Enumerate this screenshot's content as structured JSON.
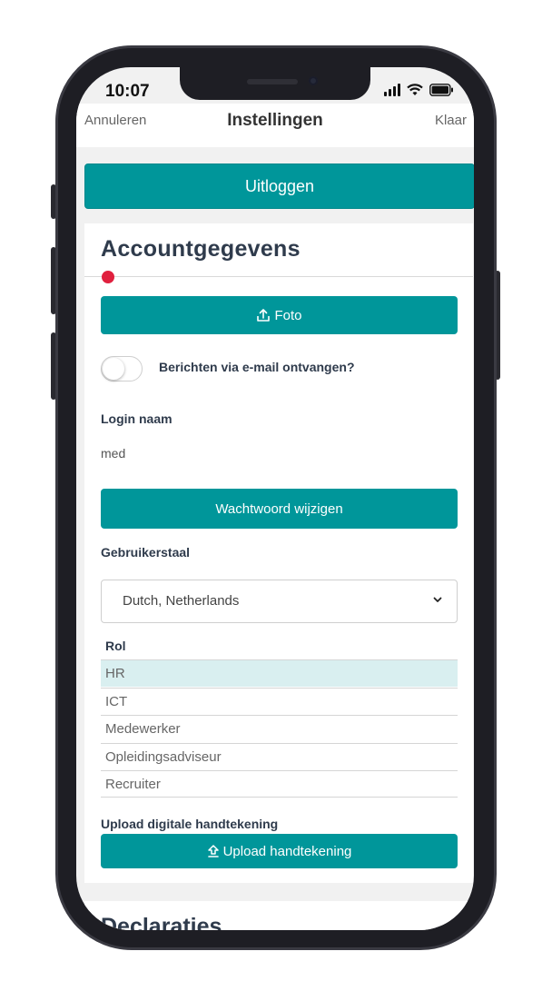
{
  "status": {
    "time": "10:07"
  },
  "nav": {
    "cancel": "Annuleren",
    "title": "Instellingen",
    "done": "Klaar"
  },
  "logout_label": "Uitloggen",
  "account": {
    "title": "Accountgegevens",
    "photo_button": "Foto",
    "email_toggle_label": "Berichten via e-mail ontvangen?",
    "email_toggle_on": false,
    "login_label": "Login naam",
    "login_value": "med",
    "change_password_button": "Wachtwoord wijzigen",
    "language_label": "Gebruikerstaal",
    "language_value": "Dutch, Netherlands",
    "role_label": "Rol",
    "roles": [
      {
        "name": "HR",
        "selected": true
      },
      {
        "name": "ICT",
        "selected": false
      },
      {
        "name": "Medewerker",
        "selected": false
      },
      {
        "name": "Opleidingsadviseur",
        "selected": false
      },
      {
        "name": "Recruiter",
        "selected": false
      }
    ],
    "signature_label": "Upload digitale handtekening",
    "signature_button": "Upload handtekening"
  },
  "next_section_title": "Declaraties",
  "colors": {
    "accent": "#00969a",
    "badge": "#e0203e",
    "text": "#2f3b4c"
  }
}
